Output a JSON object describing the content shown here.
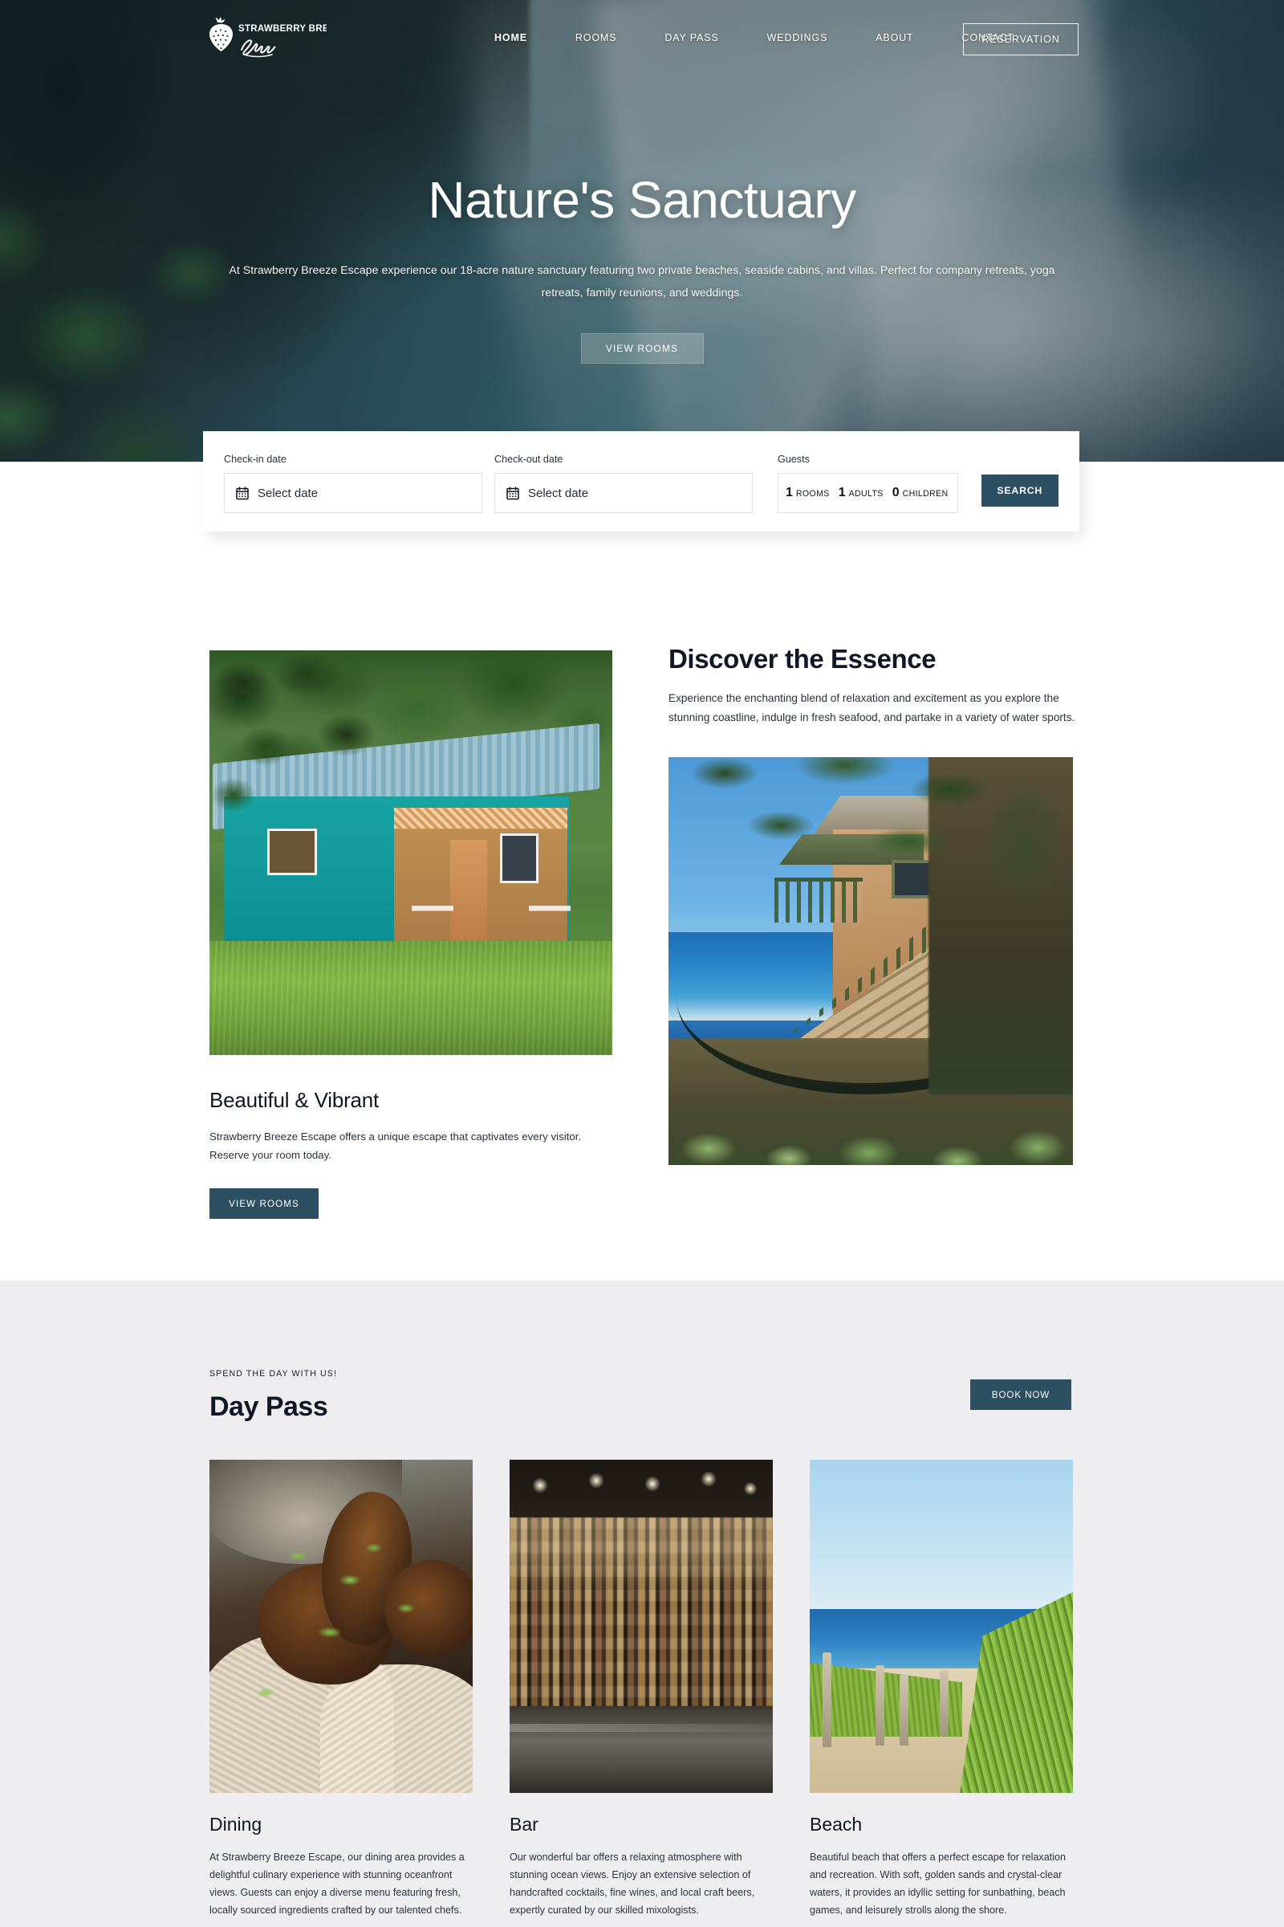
{
  "brand": {
    "name_line1": "STRAWBERRY BREEZE",
    "name_line2": "Escape",
    "logo_icon": "strawberry-icon"
  },
  "nav": {
    "items": [
      {
        "label": "HOME",
        "active": true
      },
      {
        "label": "ROOMS",
        "active": false
      },
      {
        "label": "DAY PASS",
        "active": false
      },
      {
        "label": "WEDDINGS",
        "active": false
      },
      {
        "label": "ABOUT",
        "active": false
      },
      {
        "label": "CONTACT",
        "active": false
      }
    ],
    "reservation_label": "RESERVATION"
  },
  "hero": {
    "title": "Nature's Sanctuary",
    "subtitle": "At Strawberry Breeze Escape experience our 18-acre nature sanctuary featuring two private beaches, seaside cabins, and villas. Perfect for company retreats, yoga retreats, family reunions, and weddings.",
    "cta_label": "VIEW ROOMS"
  },
  "booking": {
    "checkin_label": "Check-in date",
    "checkin_value": "Select date",
    "checkout_label": "Check-out date",
    "checkout_value": "Select date",
    "guests_label": "Guests",
    "rooms_count": "1",
    "rooms_text": "ROOMS",
    "adults_count": "1",
    "adults_text": "ADULTS",
    "children_count": "0",
    "children_text": "CHILDREN",
    "search_label": "SEARCH",
    "calendar_icon": "calendar-icon"
  },
  "discover": {
    "title": "Discover the Essence",
    "body": "Experience the enchanting blend of relaxation and excitement as you explore the stunning coastline, indulge in fresh seafood, and partake in a variety of water sports.",
    "cabin_image_alt": "teal-cabin-photo",
    "villa_image_alt": "beachfront-villa-hammock-photo"
  },
  "beautiful": {
    "title": "Beautiful & Vibrant",
    "body": "Strawberry Breeze Escape offers a unique escape that captivates every visitor. Reserve your room today.",
    "cta_label": "VIEW ROOMS"
  },
  "daypass": {
    "eyebrow": "SPEND THE DAY WITH US!",
    "title": "Day Pass",
    "book_label": "BOOK NOW",
    "cards": [
      {
        "title": "Dining",
        "body": "At Strawberry Breeze Escape, our dining area provides a delightful culinary experience with stunning oceanfront views. Guests can enjoy a diverse menu featuring fresh, locally sourced ingredients crafted by our talented chefs.",
        "image_alt": "jerk-chicken-rice-photo"
      },
      {
        "title": "Bar",
        "body": "Our wonderful bar offers a relaxing atmosphere with stunning ocean views. Enjoy an extensive selection of handcrafted cocktails, fine wines, and local craft beers, expertly curated by our skilled mixologists.",
        "image_alt": "bar-bottles-photo"
      },
      {
        "title": "Beach",
        "body": "Beautiful beach that offers a perfect escape for relaxation and recreation. With soft, golden sands and crystal-clear waters, it provides an idyllic setting for sunbathing, beach games, and leisurely strolls along the shore.",
        "image_alt": "beach-dune-path-photo"
      }
    ]
  },
  "colors": {
    "accent": "#2c5061",
    "hero_overlay": "#101c24",
    "section_bg": "#eeedf0",
    "text_dark": "#101726"
  }
}
